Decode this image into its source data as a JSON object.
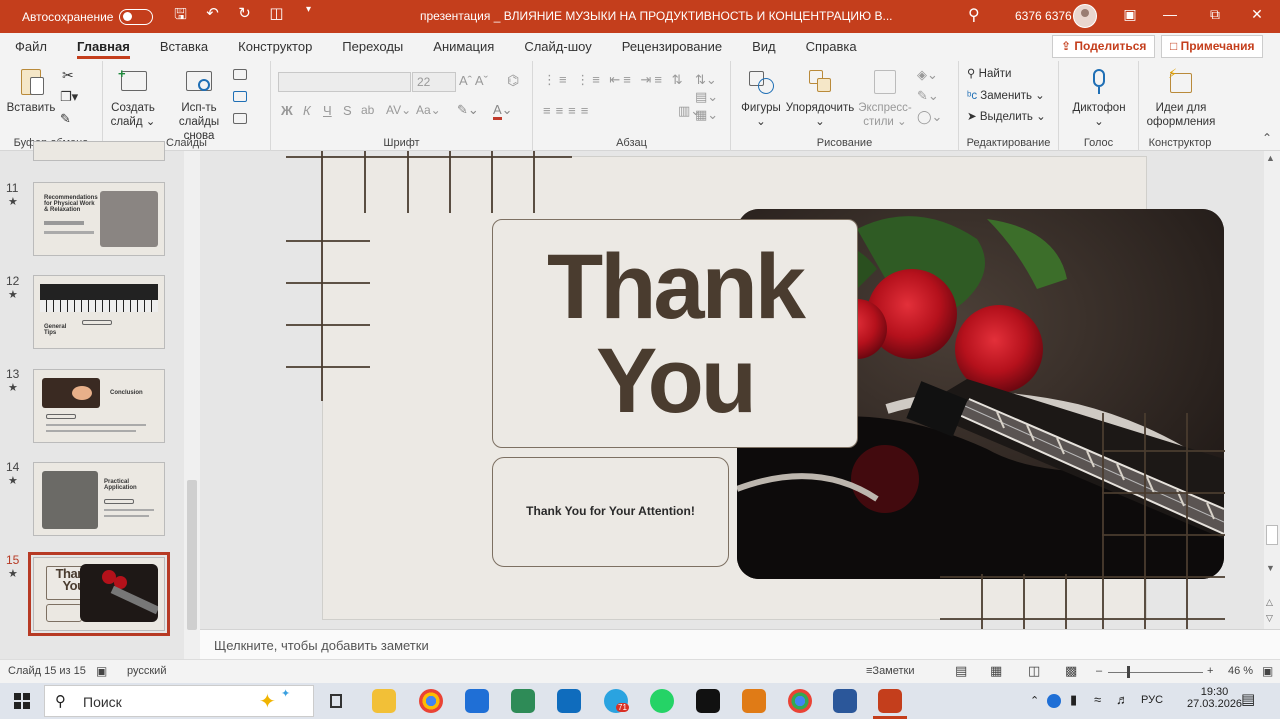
{
  "titlebar": {
    "autosave_label": "Автосохранение",
    "doc_title": "презентация _ ВЛИЯНИЕ МУЗЫКИ НА ПРОДУКТИВНОСТЬ И КОНЦЕНТРАЦИЮ В...",
    "user_name": "6376 6376"
  },
  "menu": {
    "items": [
      "Файл",
      "Главная",
      "Вставка",
      "Конструктор",
      "Переходы",
      "Анимация",
      "Слайд-шоу",
      "Рецензирование",
      "Вид",
      "Справка"
    ],
    "active_index": 1,
    "share_label": "Поделиться",
    "comments_label": "Примечания"
  },
  "ribbon": {
    "clipboard": {
      "paste": "Вставить",
      "label": "Буфер обмена"
    },
    "slides": {
      "new_slide_1": "Создать",
      "new_slide_2": "слайд",
      "reuse_1": "Исп-ть",
      "reuse_2": "слайды снова",
      "label": "Слайды"
    },
    "font": {
      "size": "22",
      "bold": "Ж",
      "italic": "К",
      "underline": "Ч",
      "strike": "S",
      "label": "Шрифт"
    },
    "paragraph": {
      "label": "Абзац"
    },
    "drawing": {
      "shapes": "Фигуры",
      "arrange": "Упорядочить",
      "styles_1": "Экспресс-",
      "styles_2": "стили",
      "label": "Рисование"
    },
    "editing": {
      "find": "Найти",
      "replace": "Заменить",
      "select": "Выделить",
      "label": "Редактирование"
    },
    "voice": {
      "dictate": "Диктофон",
      "label": "Голос"
    },
    "designer": {
      "ideas_1": "Идеи для",
      "ideas_2": "оформления",
      "label": "Конструктор"
    }
  },
  "thumbnails": [
    {
      "num": "11",
      "title": "Recommendations for Physical Work & Relaxation"
    },
    {
      "num": "12",
      "title": "General Tips"
    },
    {
      "num": "13",
      "title": "Conclusion"
    },
    {
      "num": "14",
      "title": "Practical Application"
    },
    {
      "num": "15",
      "title_line1": "Thank",
      "title_line2": "You"
    }
  ],
  "slide": {
    "thank_line1": "Thank",
    "thank_line2": "You",
    "attention": "Thank You for Your Attention!"
  },
  "notes_placeholder": "Щелкните, чтобы добавить заметки",
  "status": {
    "slide_counter": "Слайд 15 из 15",
    "language": "русский",
    "notes_label": "Заметки",
    "zoom": "46 %"
  },
  "taskbar": {
    "search_label": "Поиск",
    "lang": "РУС",
    "time": "19:30",
    "date": "27.03.2026",
    "telegram_badge": "71"
  },
  "colors": {
    "accent": "#c43e1c",
    "slide_bg": "#ece9e4",
    "slide_text": "#4a3c2f"
  }
}
